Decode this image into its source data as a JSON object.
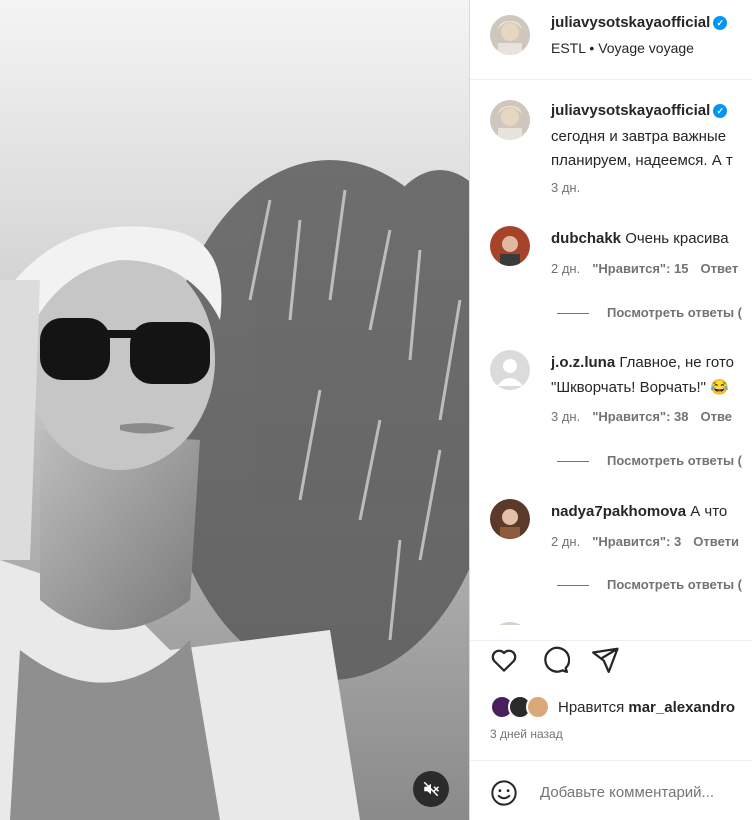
{
  "post": {
    "author": "juliavysotskayaofficial",
    "audio_artist": "ESTL",
    "audio_separator": "•",
    "audio_track": "Voyage voyage"
  },
  "caption": {
    "author": "juliavysotskayaofficial",
    "lines": [
      "сегодня и завтра важные",
      "планируем, надеемся. А т"
    ],
    "time": "3 дн."
  },
  "comments": [
    {
      "user": "dubchakk",
      "lines": [
        "Очень красива"
      ],
      "time": "2 дн.",
      "likes": "\"Нравится\": 15",
      "reply": "Ответ",
      "view_replies": "Посмотреть ответы ("
    },
    {
      "user": "j.o.z.luna",
      "lines": [
        "Главное, не гото",
        "\"Шкворчать! Ворчать!\" 😂"
      ],
      "time": "3 дн.",
      "likes": "\"Нравится\": 38",
      "reply": "Отве",
      "view_replies": "Посмотреть ответы ("
    },
    {
      "user": "nadya7pakhomova",
      "lines": [
        "А что"
      ],
      "time": "2 дн.",
      "likes": "\"Нравится\": 3",
      "reply": "Ответи",
      "view_replies": "Посмотреть ответы ("
    }
  ],
  "likes": {
    "prefix": "Нравится",
    "user": "mar_alexandro",
    "ago": "3 дней назад"
  },
  "add_comment": {
    "placeholder": "Добавьте комментарий..."
  },
  "icons": {
    "like": "heart-icon",
    "comment": "comment-icon",
    "share": "paper-plane-icon",
    "emoji": "smiley-icon",
    "mute": "speaker-muted-icon",
    "verified": "verified-badge-icon"
  },
  "colors": {
    "verified": "#0095f6",
    "secondary_text": "#737373",
    "border": "#dbdbdb"
  }
}
